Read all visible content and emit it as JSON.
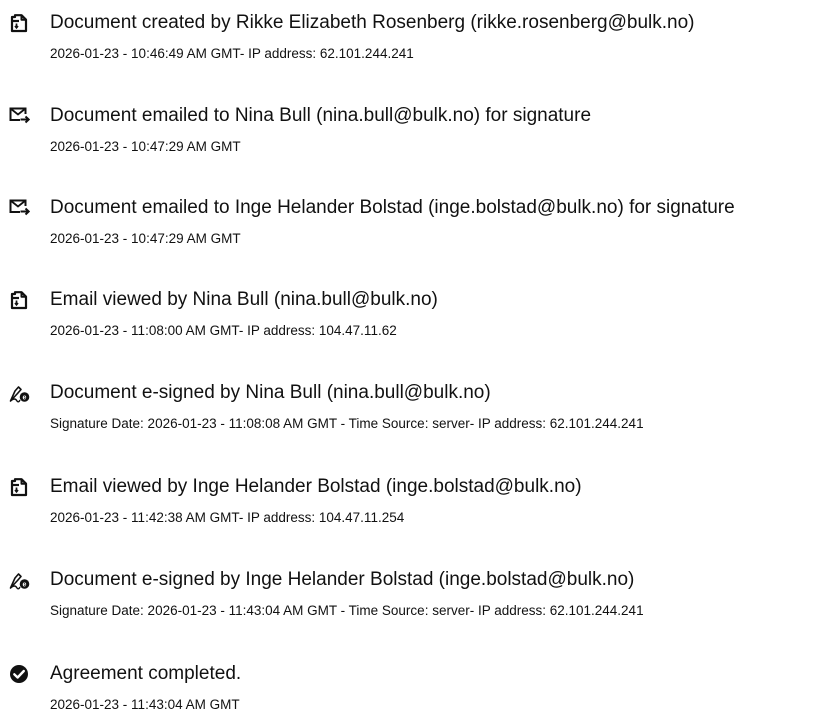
{
  "events": [
    {
      "icon": "document-icon",
      "title": "Document created by Rikke Elizabeth Rosenberg (rikke.rosenberg@bulk.no)",
      "meta": "2026-01-23 - 10:46:49 AM GMT- IP address: 62.101.244.241"
    },
    {
      "icon": "email-sent-icon",
      "title": "Document emailed to Nina Bull (nina.bull@bulk.no) for signature",
      "meta": "2026-01-23 - 10:47:29 AM GMT"
    },
    {
      "icon": "email-sent-icon",
      "title": "Document emailed to Inge Helander Bolstad (inge.bolstad@bulk.no) for signature",
      "meta": "2026-01-23 - 10:47:29 AM GMT"
    },
    {
      "icon": "document-icon",
      "title": "Email viewed by Nina Bull (nina.bull@bulk.no)",
      "meta": "2026-01-23 - 11:08:00 AM GMT- IP address: 104.47.11.62"
    },
    {
      "icon": "e-sign-icon",
      "title": "Document e-signed by Nina Bull (nina.bull@bulk.no)",
      "meta": "Signature Date: 2026-01-23 - 11:08:08 AM GMT - Time Source: server- IP address: 62.101.244.241"
    },
    {
      "icon": "document-icon",
      "title": "Email viewed by Inge Helander Bolstad (inge.bolstad@bulk.no)",
      "meta": "2026-01-23 - 11:42:38 AM GMT- IP address: 104.47.11.254"
    },
    {
      "icon": "e-sign-icon",
      "title": "Document e-signed by Inge Helander Bolstad (inge.bolstad@bulk.no)",
      "meta": "Signature Date: 2026-01-23 - 11:43:04 AM GMT - Time Source: server- IP address: 62.101.244.241"
    },
    {
      "icon": "check-circle-icon",
      "title": "Agreement completed.",
      "meta": "2026-01-23 - 11:43:04 AM GMT"
    }
  ]
}
